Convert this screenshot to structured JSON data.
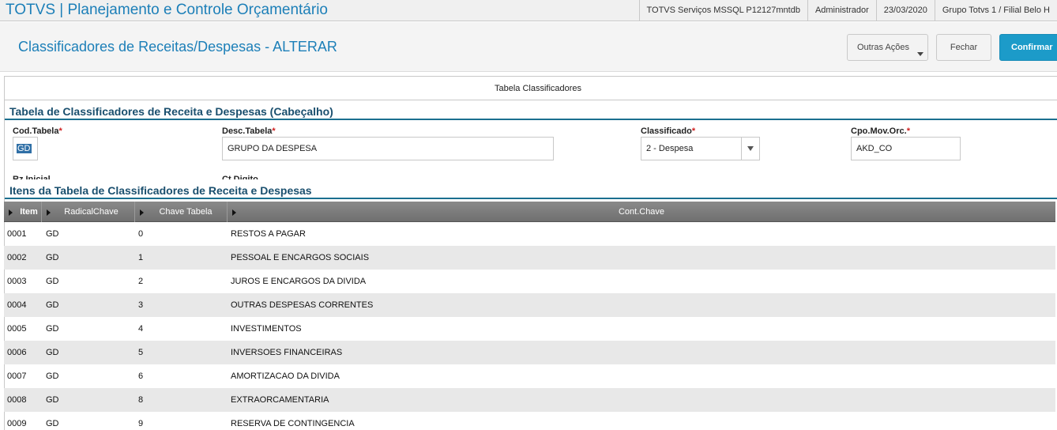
{
  "app": {
    "title": "TOTVS | Planejamento e Controle Orçamentário",
    "environment": "TOTVS Serviços MSSQL P12127mntdb",
    "user": "Administrador",
    "date": "23/03/2020",
    "branch": "Grupo Totvs 1 / Filial Belo H"
  },
  "header": {
    "page_title": "Classificadores de Receitas/Despesas - ALTERAR",
    "buttons": {
      "outras_acoes": "Outras Ações",
      "fechar": "Fechar",
      "confirmar": "Confirmar"
    }
  },
  "tab": {
    "label": "Tabela Classificadores"
  },
  "form": {
    "section_title": "Tabela de Classificadores de Receita e Despesas (Cabeçalho)",
    "required_mark": "*",
    "cod_tabela": {
      "label": "Cod.Tabela",
      "value": "GD"
    },
    "desc_tabela": {
      "label": "Desc.Tabela",
      "value": "GRUPO DA DESPESA"
    },
    "classificado": {
      "label": "Classificado",
      "value": "2 - Despesa"
    },
    "cpo_mov_orc": {
      "label": "Cpo.Mov.Orc.",
      "value": "AKD_CO"
    },
    "cut_label_1": "Rz.Inicial",
    "cut_label_2": "Ct.Digito"
  },
  "grid": {
    "section_title": "Itens da Tabela de Classificadores de Receita e Despesas",
    "columns": [
      "Item",
      "RadicalChave",
      "Chave Tabela",
      "Cont.Chave"
    ],
    "rows": [
      [
        "0001",
        "GD",
        "0",
        "RESTOS A PAGAR"
      ],
      [
        "0002",
        "GD",
        "1",
        "PESSOAL E ENCARGOS SOCIAIS"
      ],
      [
        "0003",
        "GD",
        "2",
        "JUROS E ENCARGOS DA DIVIDA"
      ],
      [
        "0004",
        "GD",
        "3",
        "OUTRAS DESPESAS CORRENTES"
      ],
      [
        "0005",
        "GD",
        "4",
        "INVESTIMENTOS"
      ],
      [
        "0006",
        "GD",
        "5",
        "INVERSOES FINANCEIRAS"
      ],
      [
        "0007",
        "GD",
        "6",
        "AMORTIZACAO DA DIVIDA"
      ],
      [
        "0008",
        "GD",
        "8",
        "EXTRAORCAMENTARIA"
      ],
      [
        "0009",
        "GD",
        "9",
        "RESERVA DE CONTINGENCIA"
      ]
    ]
  },
  "colors": {
    "accent": "#1c7fb8",
    "confirm_button": "#1c9bc9",
    "section_line": "#1b6f8f",
    "grid_header": "#7a7a7a",
    "required": "#d02020"
  },
  "icons": {
    "dropdown": "chevron-down-icon",
    "column_sort": "triangle-right-icon"
  }
}
